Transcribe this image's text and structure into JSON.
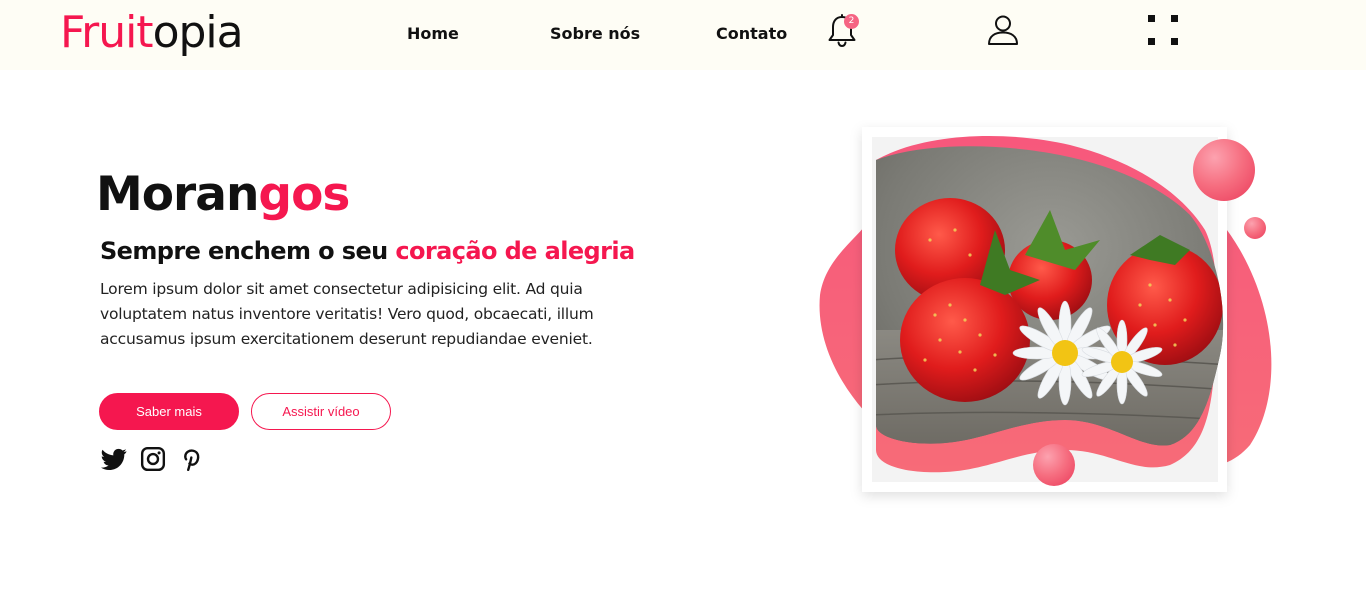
{
  "header": {
    "logo_part1": "Fruit",
    "logo_part2": "opia",
    "nav": {
      "home": "Home",
      "about": "Sobre nós",
      "contact": "Contato"
    },
    "notification_count": "2",
    "icons": [
      "bell-icon",
      "user-icon",
      "grid-menu-icon"
    ]
  },
  "hero": {
    "title_part1": "Moran",
    "title_part2": "gos",
    "subtitle_part1": "Sempre enchem o seu ",
    "subtitle_part2": "coração de alegria",
    "description": "Lorem ipsum dolor sit amet consectetur adipisicing elit. Ad quia voluptatem natus inventore veritatis! Vero quod, obcaecati, illum accusamus ipsum exercitationem deserunt repudiandae eveniet.",
    "primary_button": "Saber mais",
    "secondary_button": "Assistir vídeo",
    "social_icons": [
      "twitter-icon",
      "instagram-icon",
      "pinterest-icon"
    ],
    "image_subject": "strawberries-with-daisies"
  },
  "colors": {
    "accent": "#f5174f",
    "blob": "#f75f7a",
    "header_bg": "#fefdf5",
    "text": "#111111"
  }
}
